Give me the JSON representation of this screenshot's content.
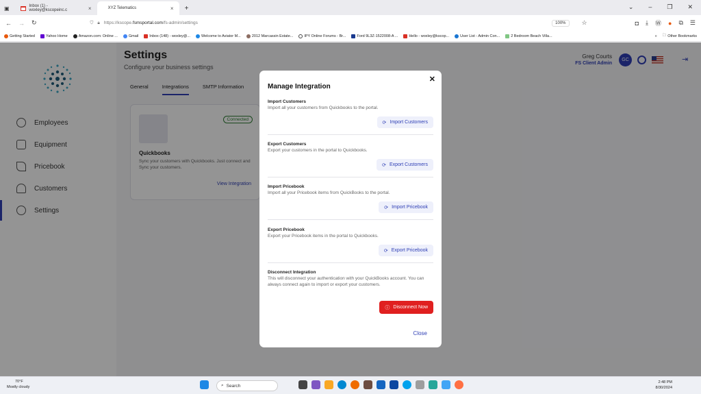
{
  "browser": {
    "tabs": [
      {
        "label": "Inbox (1) - woxley@kscopeinc.c"
      },
      {
        "label": "XYZ Telematics"
      }
    ],
    "url_prefix": "https://kscope.",
    "url_domain": "fsmsportal.com",
    "url_path": "/fs-admin/settings",
    "zoom": "100%",
    "bookmarks": [
      "Getting Started",
      "Yahoo Home",
      "Amazon.com: Online ...",
      "Gmail",
      "Inbox (148) - woxley@...",
      "Welcome to Aviator M...",
      "2012 Marcassin Estate...",
      "IPY Online Forums - Br...",
      "Ford 9L3Z-1522008-A ...",
      "Hello - woxley@kscop...",
      "User List - Admin Con...",
      "2 Bedroom Beach Villa...",
      "Other Bookmarks"
    ],
    "colors": {
      "accent": "#2f3fb5",
      "danger": "#e02020",
      "success": "#2e7d32"
    }
  },
  "sidebar": {
    "items": [
      {
        "label": "Employees",
        "icon": "person-icon"
      },
      {
        "label": "Equipment",
        "icon": "truck-icon"
      },
      {
        "label": "Pricebook",
        "icon": "wrench-icon"
      },
      {
        "label": "Customers",
        "icon": "people-icon"
      },
      {
        "label": "Settings",
        "icon": "gear-icon"
      }
    ]
  },
  "header": {
    "title": "Settings",
    "subtitle": "Configure your business settings",
    "user_name": "Greg Courts",
    "user_role": "FS Client Admin",
    "initials": "GC"
  },
  "settings_tabs": [
    "General",
    "Integrations",
    "SMTP Information"
  ],
  "integration_card": {
    "status": "Connected",
    "name": "Quickbooks",
    "description": "Sync your customers with Quickbooks. Just connect and Sync your customers.",
    "link": "View Integration"
  },
  "modal": {
    "title": "Manage Integration",
    "close_label": "Close",
    "sections": [
      {
        "title": "Import Customers",
        "desc": "Import all your customers from Quickbooks to the portal.",
        "button": "Import Customers"
      },
      {
        "title": "Export Customers",
        "desc": "Export your customers in the portal to Quickbooks.",
        "button": "Export Customers"
      },
      {
        "title": "Import Pricebook",
        "desc": "Import all your Pricebook items from QuickBooks to the portal.",
        "button": "Import Pricebook"
      },
      {
        "title": "Export Pricebook",
        "desc": "Export your Pricebook items in the portal to Quickbooks.",
        "button": "Export Pricebook"
      },
      {
        "title": "Disconnect Integration",
        "desc": "This will disconnect your authentication with your QuickBooks account. You can always connect again to import or export your customers.",
        "button": "Disconnect Now"
      }
    ]
  },
  "taskbar": {
    "temperature": "70°F",
    "weather": "Mostly cloudy",
    "search_placeholder": "Search",
    "time": "2:48 PM",
    "date": "8/30/2024"
  }
}
